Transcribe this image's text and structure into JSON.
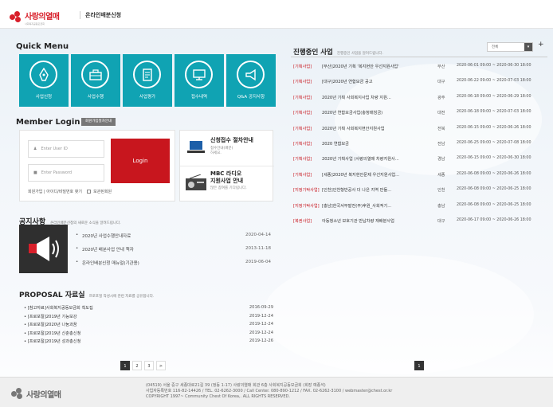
{
  "header": {
    "logo_text": "사랑의열매",
    "logo_sub": "사회복지공동모금회",
    "title": "온라인배분신청"
  },
  "quick_menu": {
    "title": "Quick Menu",
    "items": [
      {
        "label": "사업신청",
        "icon": "pen-icon"
      },
      {
        "label": "사업수행",
        "icon": "briefcase-icon"
      },
      {
        "label": "사업평가",
        "icon": "document-icon"
      },
      {
        "label": "접수내역",
        "icon": "monitor-icon"
      },
      {
        "label": "Q&A 공지사항",
        "icon": "megaphone-icon"
      }
    ],
    "color": "#10a3b3"
  },
  "member": {
    "title": "Member Login",
    "signup_button": "회원가입절차안내",
    "id_placeholder": "Enter User ID",
    "pw_placeholder": "Enter Password",
    "login_label": "Login",
    "links": "회원가입 | 아이디/비밀번호 찾기",
    "save_id": "보관된회원",
    "accent": "#c8161e"
  },
  "promo": [
    {
      "title_1": "신청접수 절차안내",
      "sub_1": "접수안내(배분)",
      "sub_2": "하세요."
    },
    {
      "title_1": "MBC 라디오",
      "title_2": "지원사업 안내",
      "sub_1": "많은 참여를 기다립니다."
    }
  ],
  "notice": {
    "title": "공지사항",
    "subtitle": "온라인배분신청의 새로운 소식을 알려드립니다.",
    "items": [
      {
        "text": "2020년 사업수행안내자료",
        "date": "2020-04-14"
      },
      {
        "text": "2020년 배분사업 안내 책자",
        "date": "2013-11-18"
      },
      {
        "text": "온라인배분신청 매뉴얼(기관용)",
        "date": "2019-06-04"
      }
    ]
  },
  "proposal": {
    "title": "PROPOSAL 자료실",
    "subtitle": "프로포절 작성시에 관련 자료를 공유합니다.",
    "items": [
      {
        "text": "[참고자료]사회복지공동모금회 척도집",
        "date": "2016-09-29"
      },
      {
        "text": "[프로포절]2019년 기능보강",
        "date": "2019-12-24"
      },
      {
        "text": "[프로포절]2020년 나눔과꿈",
        "date": "2019-12-24"
      },
      {
        "text": "[프로포절]2019년 신춘총신청",
        "date": "2019-12-24"
      },
      {
        "text": "[프로포절]2019년 성과총신청",
        "date": "2019-12-26"
      }
    ],
    "pages": [
      "1",
      "2",
      "3",
      ">"
    ]
  },
  "ongoing": {
    "title": "진행중인 사업",
    "subtitle": "진행중인 사업을 알려드립니다.",
    "select_value": "전체",
    "plus": "+",
    "rows": [
      {
        "cat": "[기획사업]",
        "title": "[부산]2020년 기획 '복지현안 우선지원사업'",
        "region": "부산",
        "period": "2020-06-01 09:00 ~ 2020-06-30 18:00"
      },
      {
        "cat": "[기획사업]",
        "title": "[대구]2020년 연합모금 공고",
        "region": "대구",
        "period": "2020-06-22 09:00 ~ 2020-07-03 18:00"
      },
      {
        "cat": "[기획사업]",
        "title": "2020년 기획 사회복지사업 차량 지원...",
        "region": "광주",
        "period": "2020-06-18 09:00 ~ 2020-06-29 18:00"
      },
      {
        "cat": "[기획사업]",
        "title": "2020년 연합모금사업(충청매칭금)",
        "region": "대전",
        "period": "2020-06-18 09:00 ~ 2020-07-03 18:00"
      },
      {
        "cat": "[기획사업]",
        "title": "2020년 기획 사회복지현안지원사업",
        "region": "전북",
        "period": "2020-06-15 09:00 ~ 2020-06-26 18:00"
      },
      {
        "cat": "[기획사업]",
        "title": "2020 연합모금",
        "region": "전남",
        "period": "2020-06-25 09:00 ~ 2020-07-08 18:00"
      },
      {
        "cat": "[기획사업]",
        "title": "2020년 기획사업 (사랑의열매 차량지원사...",
        "region": "경남",
        "period": "2020-06-15 09:00 ~ 2020-06-30 18:00"
      },
      {
        "cat": "[기획사업]",
        "title": "[세종]2020년 복지현안문제 우선지원사업...",
        "region": "세종",
        "period": "2020-06-08 09:00 ~ 2020-06-26 18:00"
      },
      {
        "cat": "[지정기탁사업]",
        "title": "[인천]인천형반공사 더 나은 지역 만들...",
        "region": "인천",
        "period": "2020-06-08 09:00 ~ 2020-06-25 18:00"
      },
      {
        "cat": "[지정기탁사업]",
        "title": "[충남]한국서부발전(주)후원_사회적기...",
        "region": "충남",
        "period": "2020-06-08 09:00 ~ 2020-06-25 18:00"
      },
      {
        "cat": "[복권사업]",
        "title": "아동청소년 보호기관 반납차량 재배분사업",
        "region": "대구",
        "period": "2020-06-17 09:00 ~ 2020-06-26 18:00"
      }
    ],
    "pages": [
      "1"
    ]
  },
  "footer": {
    "logo_text": "사랑의열매",
    "line1": "(04519) 서울 중구 세종대로21길 39 (정동 1-17) 사랑의열매 회관 6층 사회복지공동모금회 (회장 예종석)",
    "line2": "사업자등록번호 116-82-14426 / TEL. 02-6262-3000 / Call Center. 080-890-1212 / FAX. 02-6262-3100 / webmaster@chest.or.kr",
    "line3": "COPYRIGHT 1997~ Community Chest Of Korea,. ALL RIGHTS RESERVED."
  }
}
